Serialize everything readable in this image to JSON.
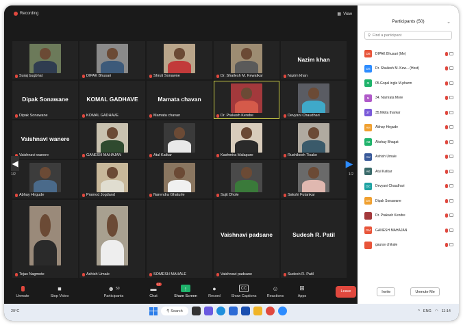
{
  "meeting": {
    "recording_label": "Recording",
    "view_label": "View",
    "page_left": "1/2",
    "page_right": "1/2",
    "tiles": [
      {
        "name": "Suraj bugbhat",
        "display": "",
        "video": true,
        "bg": "#6c7a5a",
        "shirt": "#2f3c50"
      },
      {
        "name": "DIPAK Bhusari",
        "display": "",
        "video": true,
        "bg": "#8a8a8a",
        "shirt": "#3d5a7a"
      },
      {
        "name": "Shruti Sonawne",
        "display": "",
        "video": true,
        "bg": "#b9a58a",
        "shirt": "#c23a3a"
      },
      {
        "name": "Dr. Shailesh M. Kewatkar",
        "display": "",
        "video": true,
        "bg": "#9d8c72",
        "shirt": "#5a5a5a"
      },
      {
        "name": "Nazim khan",
        "display": "Nazim khan",
        "video": false
      },
      {
        "name": "Dipak Sonawane",
        "display": "Dipak Sonawane",
        "video": false
      },
      {
        "name": "KOMAL GADHAVE",
        "display": "KOMAL GADHAVE",
        "video": false
      },
      {
        "name": "Mamata chavan",
        "display": "Mamata chavan",
        "video": false
      },
      {
        "name": "Dr. Prakash Kendre",
        "display": "",
        "video": true,
        "bg": "#a3393c",
        "shirt": "#d55a4a",
        "active": true
      },
      {
        "name": "Devyani Chaudhari",
        "display": "",
        "video": true,
        "bg": "#5a5c63",
        "shirt": "#3fa9c9"
      },
      {
        "name": "Vaishnavi wanere",
        "display": "Vaishnavi wanere",
        "video": false
      },
      {
        "name": "GANESH MAHAJAN",
        "display": "",
        "video": true,
        "bg": "#c9c2b0",
        "shirt": "#2f4a2f"
      },
      {
        "name": "Atul Katkar",
        "display": "",
        "video": true,
        "bg": "#3a3a3a",
        "shirt": "#e8e8e8"
      },
      {
        "name": "Kashmira Malapure",
        "display": "",
        "video": true,
        "bg": "#d8ccbb",
        "shirt": "#2a2a2a"
      },
      {
        "name": "Rushikesh Tisake",
        "display": "",
        "video": true,
        "bg": "#b0aaa0",
        "shirt": "#3a5a6a"
      },
      {
        "name": "Abhay Hirgude",
        "display": "",
        "video": true,
        "bg": "#3c3c3c",
        "shirt": "#4a6a8a"
      },
      {
        "name": "Pramod Jogdand",
        "display": "",
        "video": true,
        "bg": "#c8b89a",
        "shirt": "#e0ddd0"
      },
      {
        "name": "Narendra Ghaturle",
        "display": "",
        "video": true,
        "bg": "#8a7660",
        "shirt": "#f0f0f0"
      },
      {
        "name": "Sujit Dhole",
        "display": "",
        "video": true,
        "bg": "#4a4a4a",
        "shirt": "#3a7a3a"
      },
      {
        "name": "Sakshi Futankar",
        "display": "",
        "video": true,
        "bg": "#6a6a6a",
        "shirt": "#e0b8b0"
      },
      {
        "name": "Tejas Nagmote",
        "display": "",
        "video": true,
        "bg": "#9a8a7a",
        "shirt": "#2a2a2a"
      },
      {
        "name": "Ashish Umale",
        "display": "",
        "video": true,
        "bg": "#a8a090",
        "shirt": "#eeeeee"
      },
      {
        "name": "SOMESH MAHALE",
        "display": "",
        "video": false
      },
      {
        "name": "Vaishnavi padsane",
        "display": "Vaishnavi padsane",
        "video": false
      },
      {
        "name": "Sudesh R. Patil",
        "display": "Sudesh R. Patil",
        "video": false
      }
    ]
  },
  "toolbar": {
    "mute_label": "Unmute",
    "video_label": "Stop Video",
    "participants_label": "Participants",
    "participants_count": "50",
    "chat_label": "Chat",
    "chat_badge": "17",
    "share_label": "Share Screen",
    "record_label": "Record",
    "captions_label": "Show Captions",
    "reactions_label": "Reactions",
    "apps_label": "Apps",
    "leave_label": "Leave"
  },
  "panel": {
    "title": "Participants (50)",
    "search_placeholder": "Find a participant",
    "invite_label": "Invite",
    "unmute_me_label": "Unmute Me",
    "participants": [
      {
        "initials": "DB",
        "name": "DIPAK Bhusari (Me)",
        "color": "#e8553a"
      },
      {
        "initials": "DS",
        "name": "Dr. Shailesh M. Kew... (Host)",
        "color": "#2d8cff"
      },
      {
        "initials": "0I",
        "name": "05.Gopal ingle M.pharm",
        "color": "#1fb36b"
      },
      {
        "initials": "M",
        "name": "34. Namrata More",
        "color": "#b05ac9"
      },
      {
        "initials": "3T",
        "name": "35.Nikita tharkar",
        "color": "#7a5ad9"
      },
      {
        "initials": "AH",
        "name": "Abhay Hirgude",
        "color": "#f0a030"
      },
      {
        "initials": "AB",
        "name": "Akshay Bhagat",
        "color": "#1fb36b"
      },
      {
        "initials": "AU",
        "name": "Ashish Umale",
        "color": "#3a5a9a"
      },
      {
        "initials": "AK",
        "name": "Atul Katkar",
        "color": "#3a6a6a"
      },
      {
        "initials": "DC",
        "name": "Devyani Chaudhari",
        "color": "#1fa3a3"
      },
      {
        "initials": "DS",
        "name": "Dipak Sonawane",
        "color": "#f0a030"
      },
      {
        "initials": "",
        "name": "Dr. Prakash Kendre",
        "color": "#a3393c"
      },
      {
        "initials": "GM",
        "name": "GANESH MAHAJAN",
        "color": "#e8553a"
      },
      {
        "initials": "",
        "name": "gaurav chikale",
        "color": "#e8553a"
      }
    ]
  },
  "taskbar": {
    "weather": "29°C",
    "search_label": "Search",
    "tray_lang": "ENG",
    "tray_time": "11:14"
  }
}
